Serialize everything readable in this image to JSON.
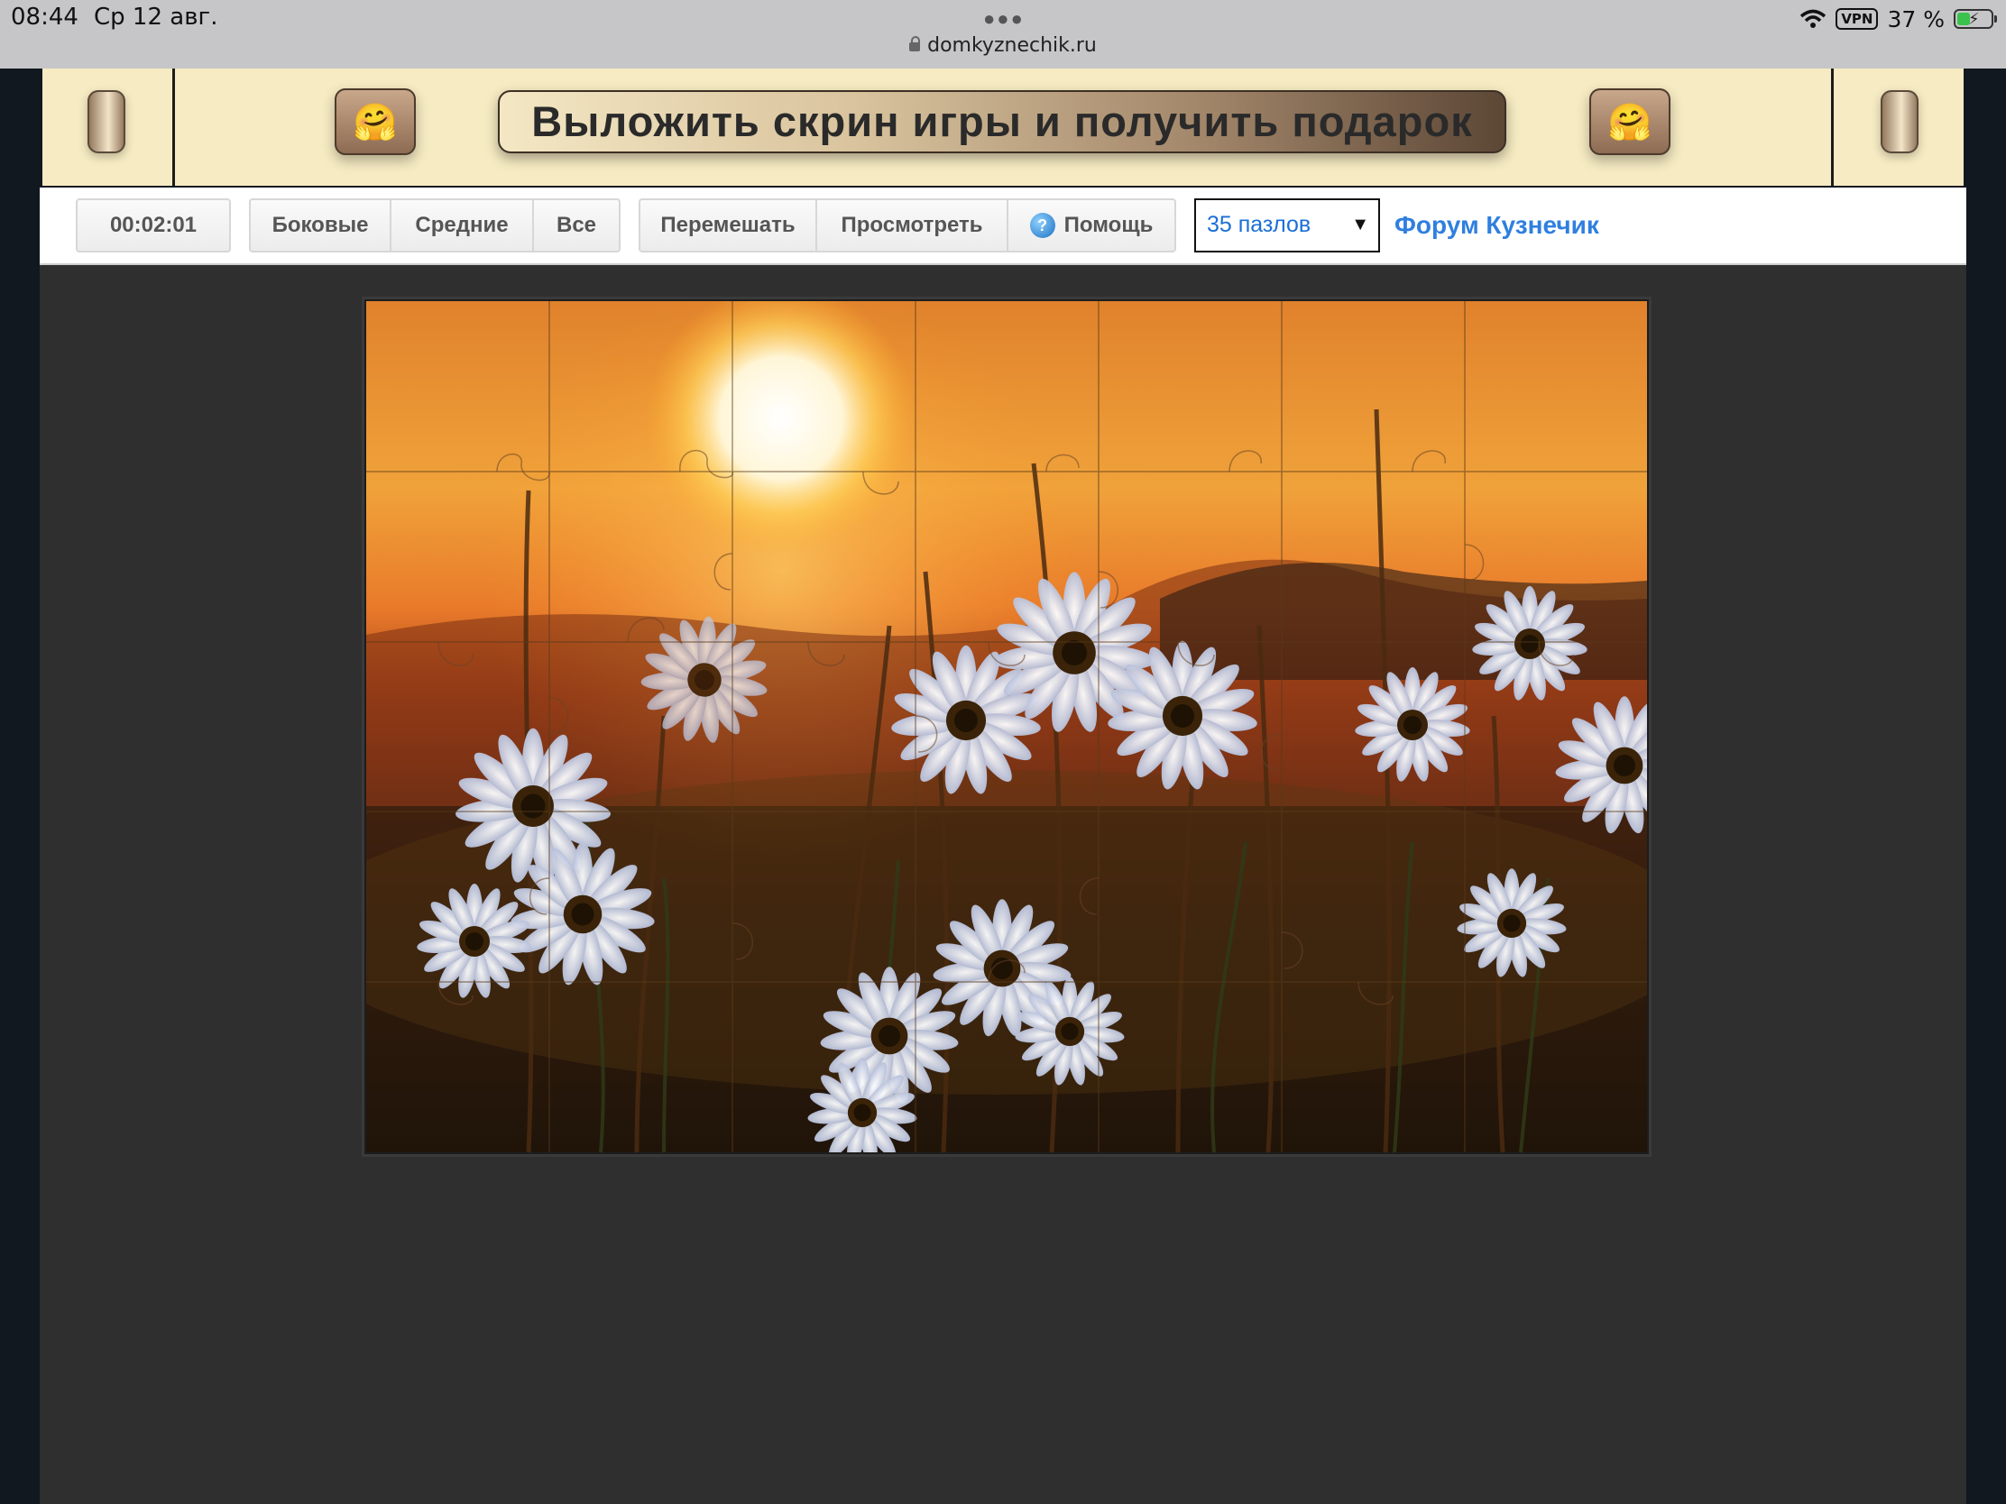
{
  "status_bar": {
    "time": "08:44",
    "date": "Ср 12 авг.",
    "url": "domkyznechik.ru",
    "vpn_label": "VPN",
    "battery": "37 %"
  },
  "banner": {
    "title": "Выложить скрин игры и получить подарок",
    "emoji": "🤗"
  },
  "toolbar": {
    "timer": "00:02:01",
    "edge_label": "Боковые",
    "middle_label": "Средние",
    "all_label": "Все",
    "shuffle_label": "Перемешать",
    "preview_label": "Просмотреть",
    "help_label": "Помощь",
    "help_icon": "question-globe-icon",
    "pieces_selected": "35 пазлов",
    "forum_link": "Форум Кузнечик"
  },
  "puzzle": {
    "grid_columns": 7,
    "grid_rows": 5,
    "image_subject": "daisies at sunset"
  },
  "colors": {
    "banner_bg": "#f6ebc2",
    "link": "#2f7fdf",
    "select_text": "#1a6fd6",
    "board_bg": "#2f2f2f"
  }
}
